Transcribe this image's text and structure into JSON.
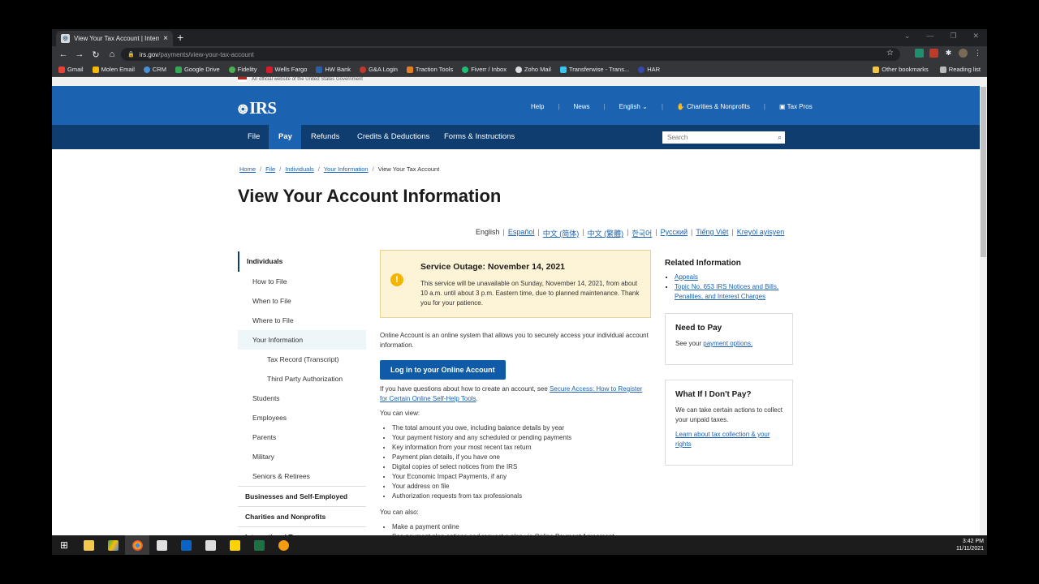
{
  "browser": {
    "tab_title": "View Your Tax Account | Internal R",
    "tab_close": "×",
    "new_tab": "+",
    "url_host": "irs.gov",
    "url_path": "/payments/view-your-tax-account",
    "bookmarks": [
      "Gmail",
      "Molen Email",
      "CRM",
      "Google Drive",
      "Fidelity",
      "Wells Fargo",
      "HW Bank",
      "G&A Login",
      "Traction Tools",
      "Fiverr / Inbox",
      "Zoho Mail",
      "Transferwise - Trans...",
      "HAR"
    ],
    "other_bookmarks": "Other bookmarks",
    "reading_list": "Reading list"
  },
  "gov_banner": "An official website of the United States Government",
  "header": {
    "logo": "IRS",
    "util": [
      "Help",
      "News",
      "English",
      "Charities & Nonprofits",
      "Tax Pros"
    ]
  },
  "menu": {
    "items": [
      "File",
      "Pay",
      "Refunds",
      "Credits & Deductions",
      "Forms & Instructions"
    ],
    "search_placeholder": "Search"
  },
  "breadcrumb": [
    "Home",
    "File",
    "Individuals",
    "Your Information",
    "View Your Tax Account"
  ],
  "page_title": "View Your Account Information",
  "languages": [
    "English",
    "Español",
    "中文 (简体)",
    "中文 (繁體)",
    "한국어",
    "Русский",
    "Tiếng Việt",
    "Kreyòl ayisyen"
  ],
  "sidebar": {
    "top": "Individuals",
    "items": [
      "How to File",
      "When to File",
      "Where to File",
      "Your Information"
    ],
    "sub": [
      "Tax Record (Transcript)",
      "Third Party Authorization"
    ],
    "items2": [
      "Students",
      "Employees",
      "Parents",
      "Military",
      "Seniors & Retirees"
    ],
    "sections": [
      "Businesses and Self-Employed",
      "Charities and Nonprofits",
      "International Taxpayers"
    ]
  },
  "alert": {
    "title": "Service Outage: November 14, 2021",
    "body": "This service will be unavailable on Sunday, November 14, 2021, from about 10 a.m. until about 3 p.m. Eastern time, due to planned maintenance. Thank you for your patience."
  },
  "content": {
    "intro": "Online Account is an online system that allows you to securely access your individual account information.",
    "login_button": "Log in to your Online Account",
    "questions_pre": "If you have questions about how to create an account, see ",
    "questions_link": "Secure Access: How to Register for Certain Online Self-Help Tools",
    "questions_post": ".",
    "you_can_view": "You can view:",
    "view_items": [
      "The total amount you owe, including balance details by year",
      "Your payment history and any scheduled or pending payments",
      "Key information from your most recent tax return",
      "Payment plan details, if you have one",
      "Digital copies of select notices from the IRS",
      "Your Economic Impact Payments, if any",
      "Your address on file",
      "Authorization requests from tax professionals"
    ],
    "you_can_also": "You can also:",
    "also_items": [
      "Make a payment online",
      "See payment plan options and request a plan via Online Payment Agreement"
    ]
  },
  "related": {
    "title": "Related Information",
    "links": [
      "Appeals",
      "Topic No. 653 IRS Notices and Bills, Penalties, and Interest Charges"
    ]
  },
  "need_to_pay": {
    "title": "Need to Pay",
    "pre": "See your ",
    "link": "payment options."
  },
  "dont_pay": {
    "title": "What If I Don't Pay?",
    "body": "We can take certain actions to collect your unpaid taxes.",
    "link": "Learn about tax collection & your rights"
  },
  "taskbar": {
    "time": "3:42 PM",
    "date": "11/11/2021"
  }
}
